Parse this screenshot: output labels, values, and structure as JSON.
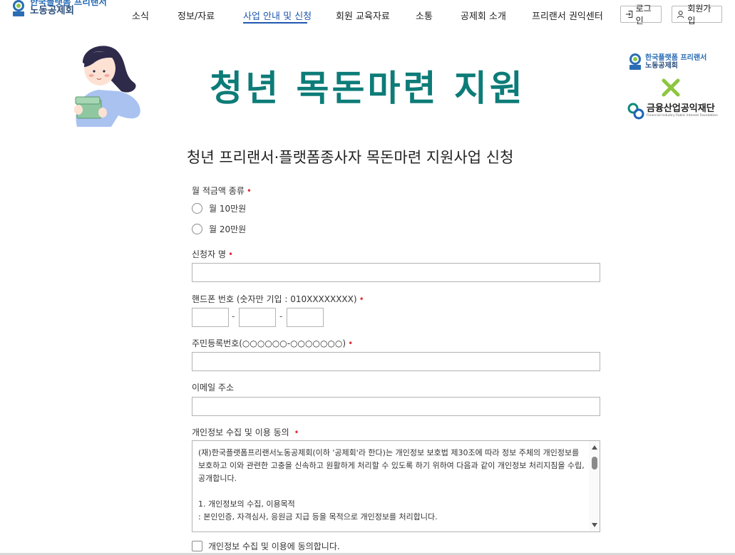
{
  "header": {
    "logo": {
      "line1": "한국플랫폼 프리랜서",
      "line2": "노동공제회"
    },
    "nav": [
      {
        "label": "소식"
      },
      {
        "label": "정보/자료"
      },
      {
        "label": "사업 안내 및 신청",
        "active": true
      },
      {
        "label": "회원 교육자료"
      },
      {
        "label": "소통"
      },
      {
        "label": "공제회 소개"
      },
      {
        "label": "프리랜서 권익센터"
      }
    ],
    "login_label": "로그인",
    "signup_label": "회원가입"
  },
  "banner": {
    "title": "청년 목돈마련 지원",
    "partner1_line1": "한국플랫폼 프리랜서",
    "partner1_line2": "노동공제회",
    "partner2_name": "금융산업공익재단",
    "partner2_sub": "Financial Industry Public Interest Foundation"
  },
  "form": {
    "title": "청년 프리랜서·플랫폼종사자 목돈마련 지원사업 신청",
    "savings_type_label": "월 적금액 종류",
    "savings_options": [
      "월 10만원",
      "월 20만원"
    ],
    "name_label": "신청자 명",
    "phone_label": "핸드폰 번호 (숫자만 기입 : 010XXXXXXXX)",
    "rrn_label": "주민등록번호(○○○○○○-○○○○○○○)",
    "email_label": "이메일 주소",
    "privacy_label": "개인정보 수집 및 이용 동의",
    "privacy_text": [
      "(재)한국플랫폼프리랜서노동공제회(이하 '공제회'라 한다)는 개인정보 보호법 제30조에 따라 정보 주체의 개인정보를 보호하고 이와 관련한 고충을 신속하고 원활하게 처리할 수 있도록 하기 위하여 다음과 같이 개인정보 처리지침을 수립, 공개합니다.",
      "1. 개인정보의 수집, 이용목적",
      ": 본인인증, 자격심사, 응원금 지급 등을 목적으로 개인정보를 처리합니다."
    ],
    "privacy_agree_label": "개인정보 수집 및 이용에 동의합니다.",
    "required_mark": "•"
  },
  "colors": {
    "accent": "#1f57b0",
    "title_teal": "#0d7c78",
    "required": "#e0313b"
  }
}
